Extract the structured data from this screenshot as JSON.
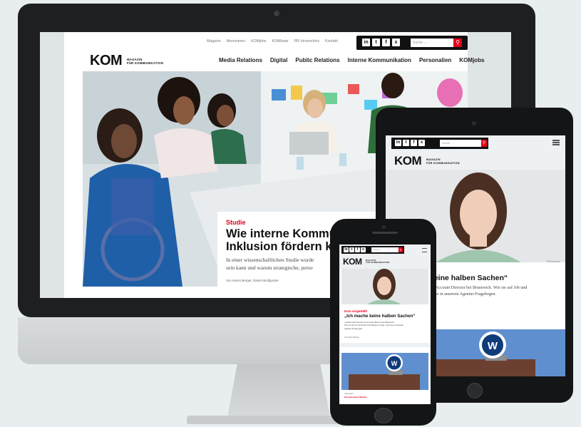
{
  "desktop": {
    "utility_nav": [
      "Magazin",
      "Abonnieren",
      "KOMjobs",
      "KOMbase",
      "PR-Verzeichnis",
      "Kontakt"
    ],
    "social_icons": [
      "linkedin-icon",
      "twitter-icon",
      "facebook-icon",
      "xing-icon"
    ],
    "social_glyphs": [
      "in",
      "t",
      "f",
      "x"
    ],
    "search_placeholder": "Suche ...",
    "logo": "KOM",
    "logo_sub_1": "MAGAZIN",
    "logo_sub_2": "FÜR KOMMUNIKATION",
    "main_nav": [
      "Media Relations",
      "Digital",
      "Public Relations",
      "Interne Kommunikation",
      "Personalien",
      "KOMjobs"
    ],
    "article": {
      "kicker": "Studie",
      "headline_1": "Wie interne Kommu",
      "headline_2": "Inklusion fördern ka",
      "teaser_1": "In einer wissenschaftlichen Studie wurde",
      "teaser_2": "sein kann und warum strategische, perso",
      "byline": "Von Karen Berger, Daniel Wolfgruber"
    }
  },
  "tablet": {
    "search_placeholder": "Suche ...",
    "logo": "KOM",
    "logo_sub_1": "MAGAZIN",
    "logo_sub_2": "FÜR KOMMUNIKATION",
    "headline": "keine halben Sachen“",
    "teaser_1": "als Account Director bei Brunswick. Wie sie auf Job und",
    "teaser_2": "ie sie in unserem Agentur-Fragebogen.",
    "photo_credit": "©Brunswick"
  },
  "phone": {
    "search_placeholder": "Suche ...",
    "logo": "KOM",
    "logo_sub_1": "MAGAZIN",
    "logo_sub_2": "FÜR KOMMUNIKATION",
    "kicker": "Kora vorgestellt",
    "headline": "„Ich mache keine halben Sachen“",
    "teaser_1": "Corinna Wolf arbeitet als Account Director bei Brunswick.",
    "teaser_2": "Wie sie auf Job und Work-Life-Balance schaut, verrät sie in unserem",
    "teaser_3": "Agentur-Fragebogen.",
    "byline": "Von Karin Berger",
    "kicker_2": "Krisenkommunikation",
    "section": "Automobil"
  },
  "colors": {
    "accent": "#e2001a",
    "dark": "#111111"
  }
}
